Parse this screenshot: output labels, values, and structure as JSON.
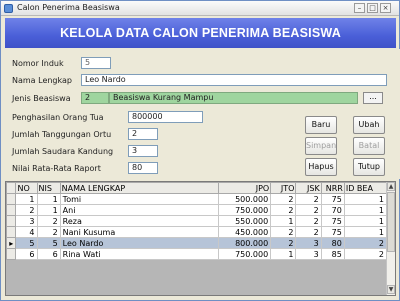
{
  "window": {
    "title": "Calon Penerima Beasiswa",
    "minimize": "–",
    "maximize": "□",
    "close": "×"
  },
  "header": {
    "title": "KELOLA DATA CALON PENERIMA BEASISWA"
  },
  "form": {
    "nomor_induk": {
      "label": "Nomor Induk",
      "value": "5"
    },
    "nama_lengkap": {
      "label": "Nama Lengkap",
      "value": "Leo Nardo"
    },
    "jenis_beasiswa": {
      "label": "Jenis Beasiswa",
      "code": "2",
      "name": "Beasiswa Kurang Mampu",
      "browse": "..."
    },
    "penghasilan": {
      "label": "Penghasilan Orang Tua",
      "value": "800000"
    },
    "tanggungan": {
      "label": "Jumlah Tanggungan Ortu",
      "value": "2"
    },
    "saudara": {
      "label": "Jumlah Saudara Kandung",
      "value": "3"
    },
    "raport": {
      "label": "Nilai Rata-Rata Raport",
      "value": "80"
    }
  },
  "buttons": {
    "baru": "Baru",
    "ubah": "Ubah",
    "simpan": "Simpan",
    "batal": "Batal",
    "hapus": "Hapus",
    "tutup": "Tutup"
  },
  "table": {
    "columns": [
      "NO",
      "NIS",
      "NAMA LENGKAP",
      "JPO",
      "JTO",
      "JSK",
      "NRR",
      "ID BEA"
    ],
    "rows": [
      [
        "1",
        "1",
        "Tomi",
        "500.000",
        "2",
        "2",
        "75",
        "1"
      ],
      [
        "2",
        "1",
        "Ani",
        "750.000",
        "2",
        "2",
        "70",
        "1"
      ],
      [
        "3",
        "2",
        "Reza",
        "550.000",
        "1",
        "2",
        "75",
        "1"
      ],
      [
        "4",
        "2",
        "Nani Kusuma",
        "450.000",
        "2",
        "2",
        "75",
        "1"
      ],
      [
        "5",
        "5",
        "Leo Nardo",
        "800.000",
        "2",
        "3",
        "80",
        "2"
      ],
      [
        "6",
        "6",
        "Rina Wati",
        "750.000",
        "1",
        "3",
        "85",
        "2"
      ]
    ],
    "selected_row": 4,
    "row_indicator": "▸"
  },
  "scrollbar": {
    "up": "▲",
    "down": "▼"
  }
}
